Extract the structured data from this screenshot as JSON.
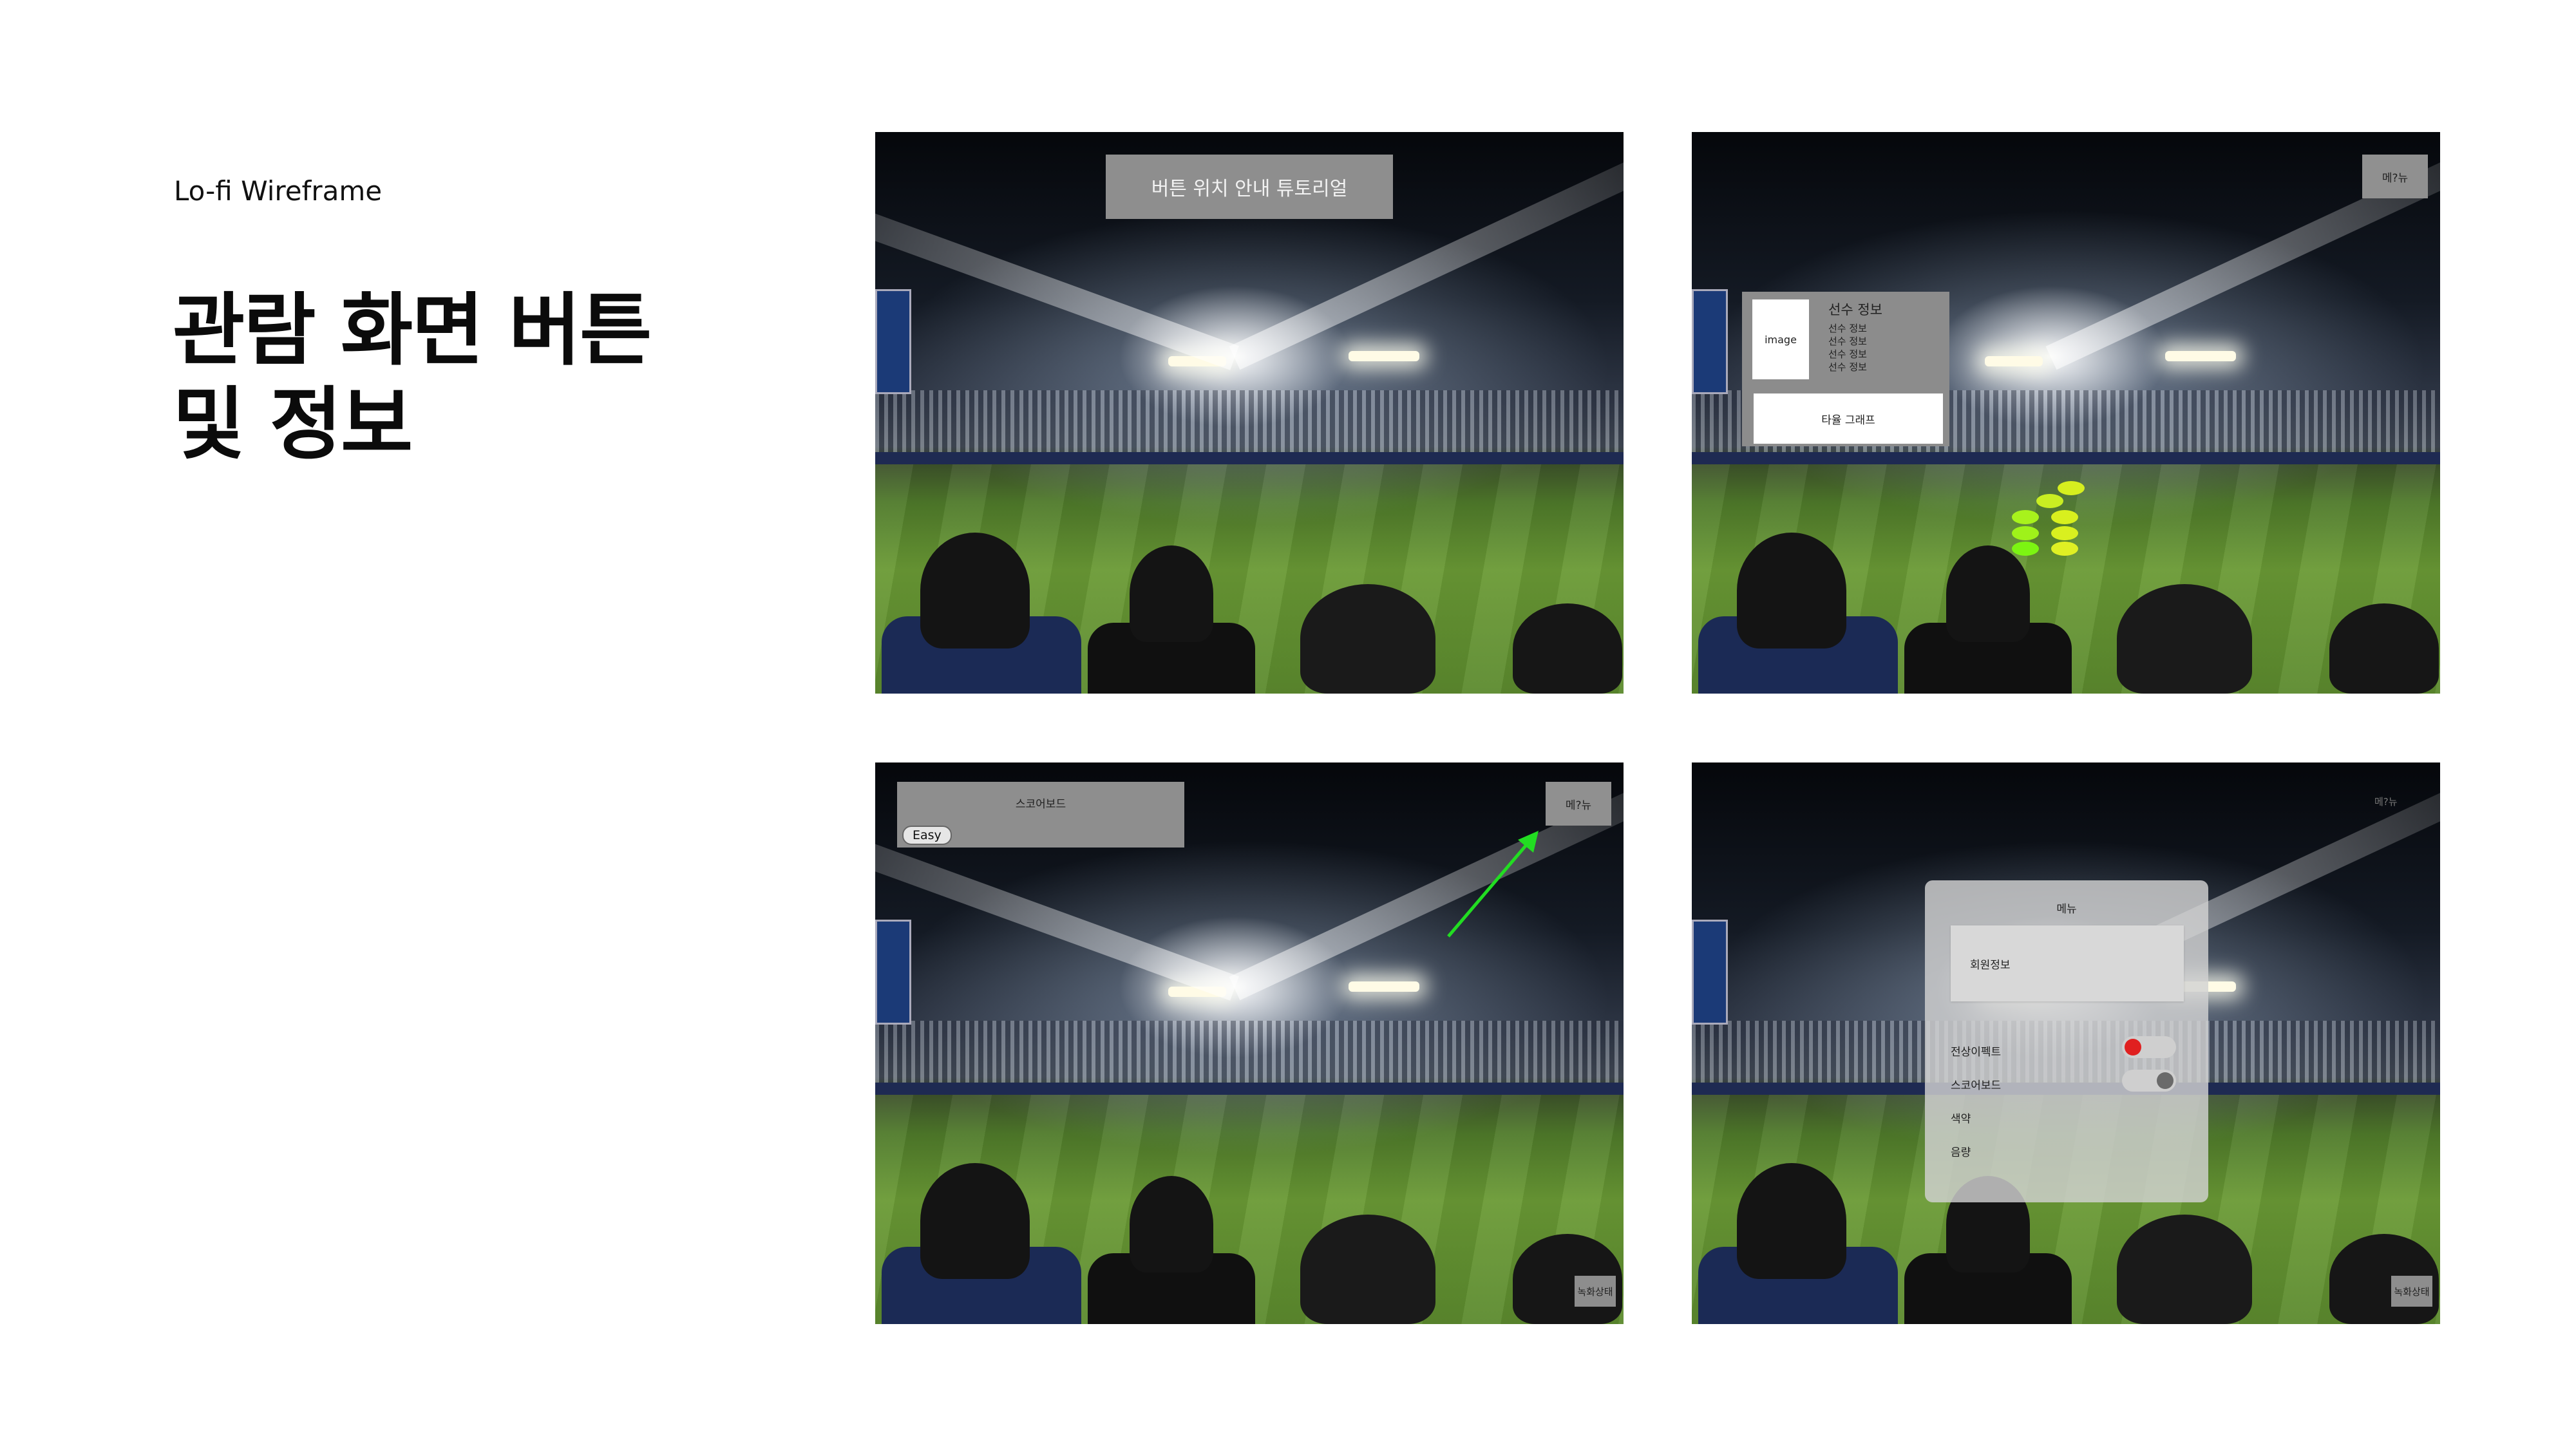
{
  "header": {
    "eyebrow": "Lo-fi Wireframe",
    "title_line1": "관람 화면 버튼",
    "title_line2": "및 정보"
  },
  "screen1": {
    "tutorial_banner": "버튼 위치 안내 튜토리얼"
  },
  "screen2": {
    "menu_button": "메?뉴",
    "player_card": {
      "image_label": "image",
      "title": "선수 정보",
      "lines": [
        "선수 정보",
        "선수 정보",
        "선수 정보",
        "선수 정보"
      ],
      "graph_button": "타율 그래프"
    },
    "dot_colors": [
      "#d6ef1f",
      "#c9ee22",
      "#a8f21c",
      "#d8f01e",
      "#9ff21a",
      "#d9f01f",
      "#7cf512",
      "#e0f024"
    ]
  },
  "screen3": {
    "scoreboard_title": "스코어보드",
    "easy_badge": "Easy",
    "menu_button": "메?뉴",
    "record_button": "녹화상태",
    "arrow_color": "#22dd22"
  },
  "screen4": {
    "menu_button": "메?뉴",
    "record_button": "녹화상태",
    "menu_panel": {
      "title": "메뉴",
      "member_info": "회원정보",
      "rows": [
        "전상이펙트",
        "스코어보드",
        "색약",
        "음량"
      ]
    },
    "toggle_on_color": "#e02020",
    "toggle_off_color": "#6a6a6a"
  }
}
